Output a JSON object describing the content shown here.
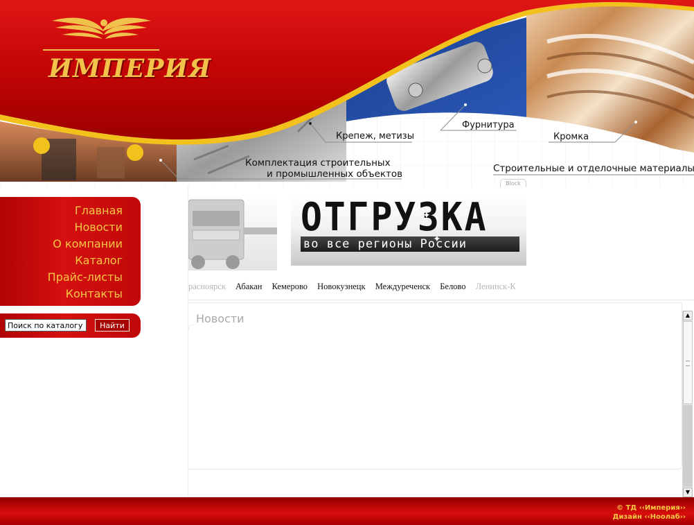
{
  "brand": {
    "name": "ИМПЕРИЯ"
  },
  "header": {
    "categories": {
      "fasteners": "Крепеж, метизы",
      "furniture_hardware": "Фурнитура",
      "edging": "Кромка",
      "completion_line1": "Комплектация строительных",
      "completion_line2": "и промышленных объектов",
      "building_materials": "Строительные и отделочные материалы"
    },
    "block_tab": "Block"
  },
  "nav": {
    "items": [
      {
        "label": "Главная"
      },
      {
        "label": "Новости"
      },
      {
        "label": "О компании"
      },
      {
        "label": "Каталог"
      },
      {
        "label": "Прайс-листы"
      },
      {
        "label": "Контакты"
      }
    ]
  },
  "search": {
    "value": "Поиск по каталогу",
    "button_label": "Найти"
  },
  "banner": {
    "title": "ОТГРУЗКА",
    "subtitle": "во все регионы России"
  },
  "ticker": {
    "cities": [
      "раснoярск",
      "Абакан",
      "Кемерово",
      "Новокузнецк",
      "Междуреченск",
      "Белово",
      "Ленинск-Ку"
    ]
  },
  "news": {
    "title": "Новости"
  },
  "footer": {
    "copyright": "© ТД ‹‹Империя››",
    "design": "Дизайн ‹‹Ноолаб››"
  },
  "colors": {
    "brand_red": "#c80808",
    "accent_gold": "#f6c842"
  }
}
